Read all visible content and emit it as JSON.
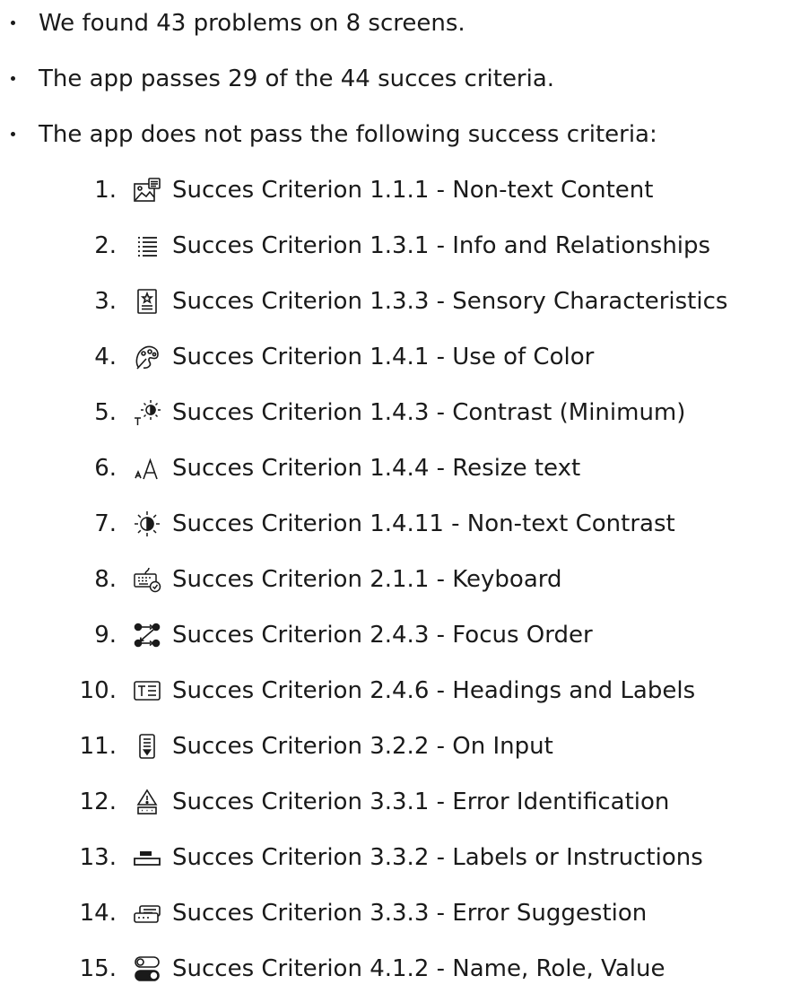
{
  "summary": [
    "We found 43 problems on 8 screens.",
    "The app passes 29 of the 44 succes criteria.",
    "The app does not pass the following success criteria:"
  ],
  "criteria": [
    {
      "number": "1.",
      "icon": "image-text-icon",
      "label": "Succes Criterion 1.1.1 - Non-text Content"
    },
    {
      "number": "2.",
      "icon": "list-lines-icon",
      "label": "Succes Criterion 1.3.1 - Info and Relationships"
    },
    {
      "number": "3.",
      "icon": "sensory-card-icon",
      "label": "Succes Criterion 1.3.3 - Sensory Characteristics"
    },
    {
      "number": "4.",
      "icon": "color-palette-icon",
      "label": "Succes Criterion 1.4.1 - Use of Color"
    },
    {
      "number": "5.",
      "icon": "text-contrast-icon",
      "label": "Succes Criterion 1.4.3 - Contrast (Minimum)"
    },
    {
      "number": "6.",
      "icon": "resize-text-icon",
      "label": "Succes Criterion 1.4.4 - Resize text"
    },
    {
      "number": "7.",
      "icon": "contrast-sun-icon",
      "label": "Succes Criterion 1.4.11 - Non-text Contrast"
    },
    {
      "number": "8.",
      "icon": "keyboard-check-icon",
      "label": "Succes Criterion 2.1.1 - Keyboard"
    },
    {
      "number": "9.",
      "icon": "focus-order-icon",
      "label": "Succes Criterion 2.4.3 - Focus Order"
    },
    {
      "number": "10.",
      "icon": "heading-label-icon",
      "label": "Succes Criterion 2.4.6 - Headings and Labels"
    },
    {
      "number": "11.",
      "icon": "input-form-icon",
      "label": "Succes Criterion 3.2.2 - On Input"
    },
    {
      "number": "12.",
      "icon": "error-warning-icon",
      "label": "Succes Criterion 3.3.1 - Error Identification"
    },
    {
      "number": "13.",
      "icon": "name-field-icon",
      "label": "Succes Criterion 3.3.2 - Labels or Instructions"
    },
    {
      "number": "14.",
      "icon": "error-suggestion-icon",
      "label": "Succes Criterion 3.3.3 - Error Suggestion"
    },
    {
      "number": "15.",
      "icon": "toggle-switch-icon",
      "label": "Succes Criterion 4.1.2 - Name, Role, Value"
    }
  ]
}
